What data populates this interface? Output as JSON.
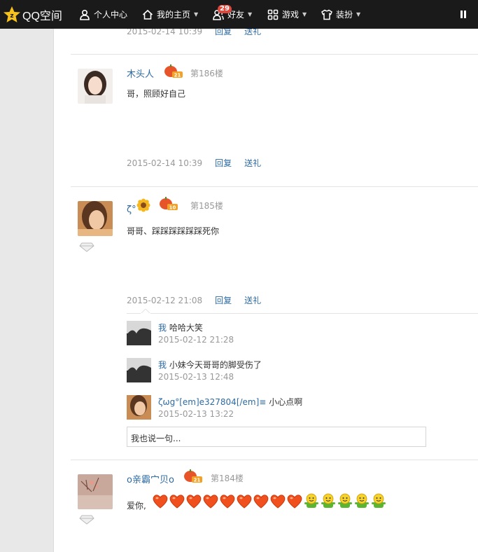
{
  "topbar": {
    "logo_text": "QQ空间",
    "nav": [
      {
        "label": "个人中心"
      },
      {
        "label": "我的主页"
      },
      {
        "label": "好友",
        "badge": "29"
      },
      {
        "label": "游戏"
      },
      {
        "label": "装扮"
      }
    ]
  },
  "posts": [
    {
      "time": "2015-02-14 10:39",
      "reply_label": "回复",
      "gift_label": "送礼"
    },
    {
      "author": "木头人",
      "floor": "第186楼",
      "text": "哥，照顾好自己",
      "time": "2015-02-14 10:39",
      "reply_label": "回复",
      "gift_label": "送礼"
    },
    {
      "author": "ζ°",
      "floor": "第185楼",
      "text": "哥哥、踩踩踩踩踩踩死你",
      "time": "2015-02-12 21:08",
      "reply_label": "回复",
      "gift_label": "送礼",
      "replies": [
        {
          "author": "我",
          "text": "哈哈大笑",
          "time": "2015-02-12 21:28"
        },
        {
          "author": "我",
          "text": "小妹今天哥哥的脚受伤了",
          "time": "2015-02-13 12:48"
        },
        {
          "author": "ζωg°[em]e327804[/em]≡",
          "text": "小心点啊",
          "time": "2015-02-13 13:22"
        }
      ],
      "reply_placeholder": "我也说一句..."
    },
    {
      "author": "o亲霸宀贝o",
      "floor": "第184楼",
      "text": "爱你,"
    }
  ],
  "colors": {
    "topbar_bg": "#1a1a1a",
    "link": "#2d6aa3",
    "meta": "#999999"
  }
}
